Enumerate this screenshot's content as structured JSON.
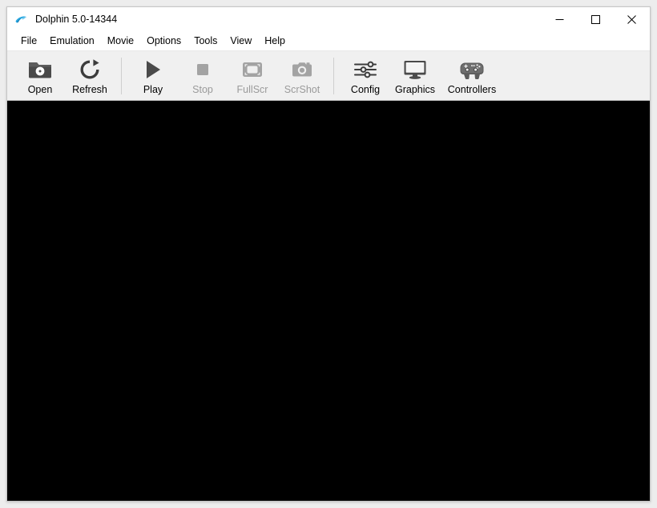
{
  "window": {
    "title": "Dolphin 5.0-14344",
    "app_icon": "dolphin-icon",
    "controls": [
      {
        "name": "minimize",
        "glyph": "minimize-icon",
        "label": "Minimize"
      },
      {
        "name": "maximize",
        "glyph": "maximize-icon",
        "label": "Maximize"
      },
      {
        "name": "close",
        "glyph": "close-icon",
        "label": "Close"
      }
    ]
  },
  "menubar": {
    "items": [
      {
        "label": "File"
      },
      {
        "label": "Emulation"
      },
      {
        "label": "Movie"
      },
      {
        "label": "Options"
      },
      {
        "label": "Tools"
      },
      {
        "label": "View"
      },
      {
        "label": "Help"
      }
    ]
  },
  "toolbar": {
    "buttons": [
      {
        "label": "Open",
        "icon": "folder-disc-icon",
        "enabled": true
      },
      {
        "label": "Refresh",
        "icon": "refresh-icon",
        "enabled": true
      },
      {
        "label": "Play",
        "icon": "play-icon",
        "enabled": true
      },
      {
        "label": "Stop",
        "icon": "stop-icon",
        "enabled": false
      },
      {
        "label": "FullScr",
        "icon": "fullscreen-icon",
        "enabled": false
      },
      {
        "label": "ScrShot",
        "icon": "camera-icon",
        "enabled": false
      },
      {
        "label": "Config",
        "icon": "sliders-icon",
        "enabled": true
      },
      {
        "label": "Graphics",
        "icon": "monitor-icon",
        "enabled": true
      },
      {
        "label": "Controllers",
        "icon": "gamepad-icon",
        "enabled": true
      }
    ]
  },
  "viewport": {
    "state": "blank",
    "background_color": "#000000"
  },
  "colors": {
    "accent": "#29a8e0",
    "titlebar_bg": "#ffffff",
    "menubar_bg": "#ffffff",
    "toolbar_bg": "#f0f0f0",
    "icon_enabled": "#3c3c3c",
    "icon_disabled": "#a0a0a0",
    "text_enabled": "#000000",
    "text_disabled": "#9a9a9a",
    "page_bg": "#ededed"
  }
}
